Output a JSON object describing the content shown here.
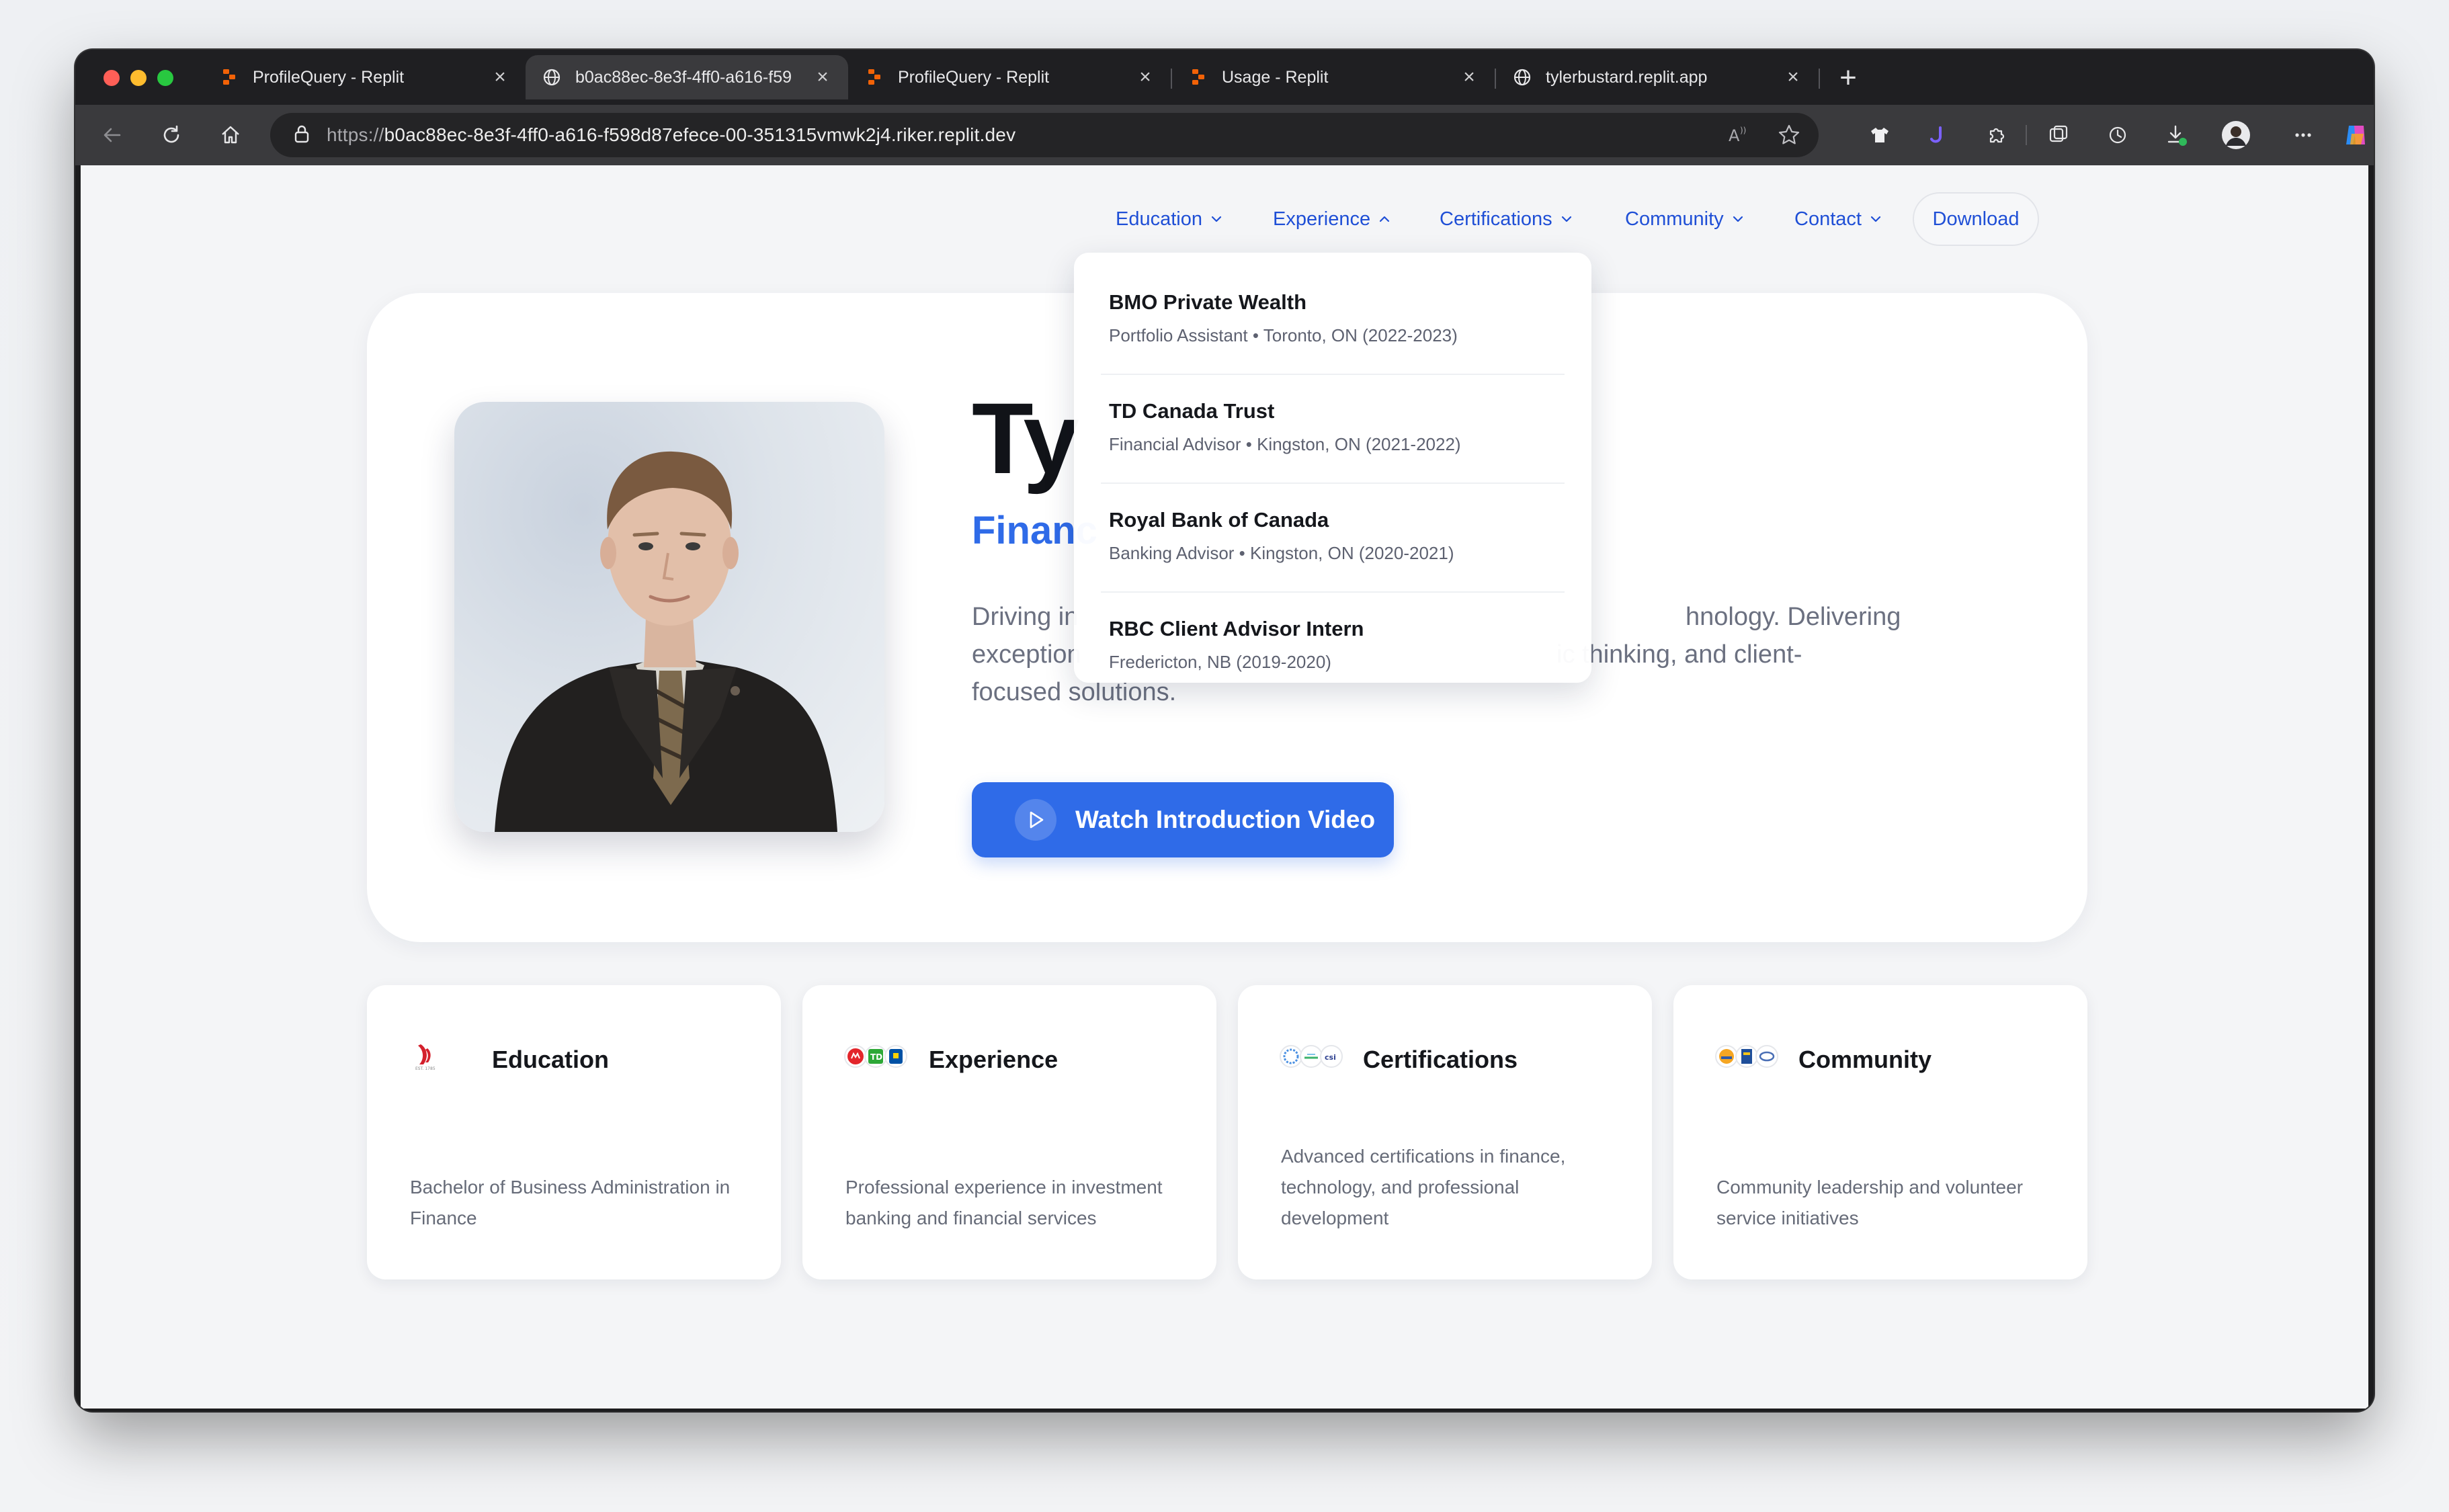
{
  "browser": {
    "tabs": [
      {
        "title": "ProfileQuery - Replit",
        "icon": "replit-icon",
        "active": false
      },
      {
        "title": "b0ac88ec-8e3f-4ff0-a616-f59",
        "icon": "globe-icon",
        "active": true
      },
      {
        "title": "ProfileQuery - Replit",
        "icon": "replit-icon",
        "active": false
      },
      {
        "title": "Usage - Replit",
        "icon": "replit-icon",
        "active": false
      },
      {
        "title": "tylerbustard.replit.app",
        "icon": "globe-icon",
        "active": false
      }
    ],
    "url_protocol": "https://",
    "url_host": "b0ac88ec-8e3f-4ff0-a616-f598d87efece-00-351315vmwk2j4.riker.replit.dev"
  },
  "nav": {
    "education": "Education",
    "experience": "Experience",
    "certifications": "Certifications",
    "community": "Community",
    "contact": "Contact",
    "download": "Download"
  },
  "hero": {
    "name_visible": "Ty",
    "role_visible": "Financ",
    "description_lines": [
      "Driving in",
      "exception",
      "focused solutions."
    ],
    "description_right_lines": [
      "hnology. Delivering",
      "ic thinking, and client-"
    ],
    "video_button": "Watch Introduction Video"
  },
  "experience_dropdown": [
    {
      "company": "BMO Private Wealth",
      "detail": "Portfolio Assistant • Toronto, ON (2022-2023)"
    },
    {
      "company": "TD Canada Trust",
      "detail": "Financial Advisor • Kingston, ON (2021-2022)"
    },
    {
      "company": "Royal Bank of Canada",
      "detail": "Banking Advisor • Kingston, ON (2020-2021)"
    },
    {
      "company": "RBC Client Advisor Intern",
      "detail": "Fredericton, NB (2019-2020)"
    }
  ],
  "cards": [
    {
      "title": "Education",
      "description": "Bachelor of Business Administration in Finance"
    },
    {
      "title": "Experience",
      "description": "Professional experience in investment banking and financial services"
    },
    {
      "title": "Certifications",
      "description": "Advanced certifications in finance, technology, and professional development"
    },
    {
      "title": "Community",
      "description": "Community leadership and volunteer service initiatives"
    }
  ],
  "colors": {
    "accent": "#2f6be8",
    "nav_link": "#1f4fd6",
    "page_bg": "#f4f5f7"
  }
}
